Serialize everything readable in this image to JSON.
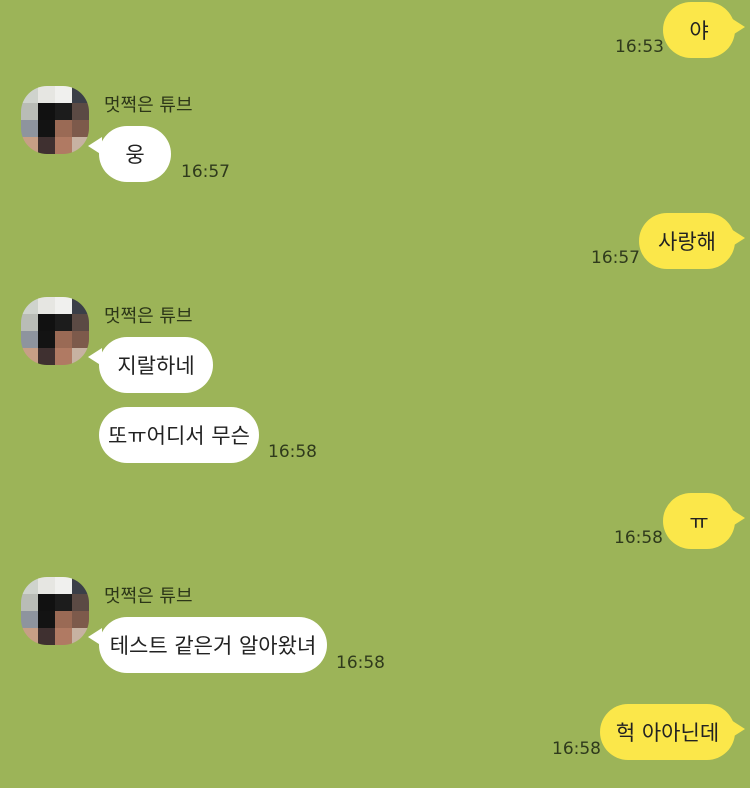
{
  "contact": {
    "name": "멋쩍은 튜브"
  },
  "messages": [
    {
      "text": "야",
      "time": "16:53"
    },
    {
      "text": "웅",
      "time": "16:57"
    },
    {
      "text": "사랑해",
      "time": "16:57"
    },
    {
      "text": "지랄하네",
      "time": ""
    },
    {
      "text": "또ㅠ어디서 무슨",
      "time": "16:58"
    },
    {
      "text": "ㅠ",
      "time": "16:58"
    },
    {
      "text": "테스트 같은거 알아왔녀",
      "time": "16:58"
    },
    {
      "text": "헉 아아닌데",
      "time": "16:58"
    }
  ],
  "colors": {
    "background": "#9cb458",
    "my_bubble": "#fbe74a",
    "their_bubble": "#ffffff"
  }
}
